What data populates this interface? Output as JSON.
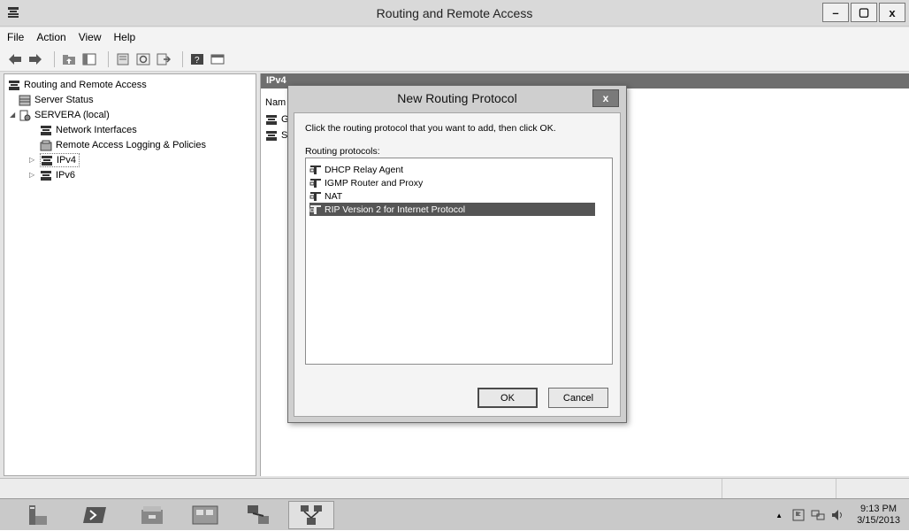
{
  "window": {
    "title": "Routing and Remote Access"
  },
  "window_buttons": {
    "minimize": "–",
    "restore": "▢",
    "close": "x"
  },
  "menu": [
    "File",
    "Action",
    "View",
    "Help"
  ],
  "toolbar_icons": [
    "back-arrow-icon",
    "forward-arrow-icon",
    "up-folder-icon",
    "show-hide-tree-icon",
    "properties-icon",
    "refresh-icon",
    "export-icon",
    "help-icon",
    "console-icon"
  ],
  "tree": {
    "root": "Routing and Remote Access",
    "items": [
      {
        "label": "Server Status"
      },
      {
        "label": "SERVERA (local)"
      },
      {
        "label": "Network Interfaces"
      },
      {
        "label": "Remote Access Logging & Policies"
      },
      {
        "label": "IPv4"
      },
      {
        "label": "IPv6"
      }
    ]
  },
  "right_pane": {
    "header": "IPv4",
    "column": "Nam",
    "rows": [
      "G",
      "St"
    ]
  },
  "dialog": {
    "title": "New Routing Protocol",
    "close": "x",
    "prompt": "Click the routing protocol that you want to add, then click OK.",
    "list_label": "Routing protocols:",
    "protocols": [
      {
        "label": "DHCP Relay Agent",
        "selected": false
      },
      {
        "label": "IGMP Router and Proxy",
        "selected": false
      },
      {
        "label": "NAT",
        "selected": false
      },
      {
        "label": "RIP Version 2 for Internet Protocol",
        "selected": true
      }
    ],
    "ok": "OK",
    "cancel": "Cancel"
  },
  "taskbar": {
    "buttons": [
      "server-manager-icon",
      "powershell-icon",
      "file-explorer-icon",
      "control-panel-icon",
      "network-icon",
      "routing-icon"
    ],
    "time": "9:13 PM",
    "date": "3/15/2013"
  },
  "colors": {
    "selection": "#555555",
    "header": "#6e6e6e",
    "titlebar": "#d9d9d9"
  }
}
